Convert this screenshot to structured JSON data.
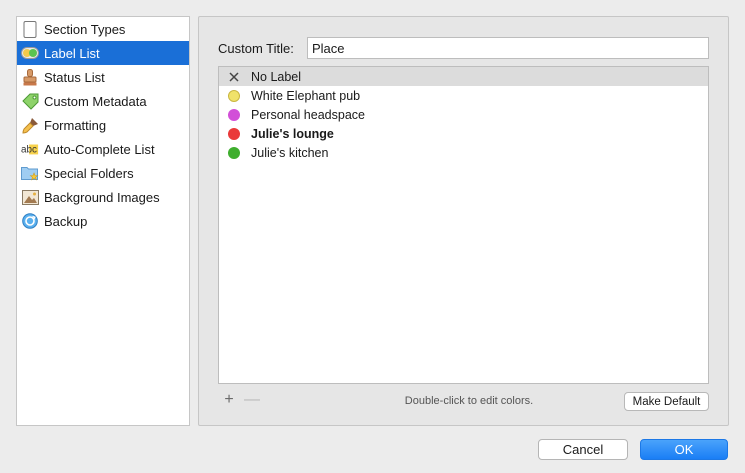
{
  "sidebar": {
    "items": [
      {
        "label": "Section Types",
        "icon": "document-icon"
      },
      {
        "label": "Label List",
        "icon": "label-toggle-icon",
        "selected": true
      },
      {
        "label": "Status List",
        "icon": "stamp-icon"
      },
      {
        "label": "Custom Metadata",
        "icon": "tag-icon"
      },
      {
        "label": "Formatting",
        "icon": "brush-icon"
      },
      {
        "label": "Auto-Complete List",
        "icon": "abc-icon"
      },
      {
        "label": "Special Folders",
        "icon": "folder-star-icon"
      },
      {
        "label": "Background Images",
        "icon": "picture-icon"
      },
      {
        "label": "Backup",
        "icon": "backup-icon"
      }
    ]
  },
  "form": {
    "custom_title_label": "Custom Title:",
    "custom_title_value": "Place"
  },
  "labels": [
    {
      "name": "No Label",
      "marker": "x",
      "color": null,
      "bold": false
    },
    {
      "name": "White Elephant pub",
      "marker": "dot",
      "color": "#f0e26a",
      "bold": false
    },
    {
      "name": "Personal headspace",
      "marker": "dot",
      "color": "#d24fd8",
      "bold": false
    },
    {
      "name": "Julie's lounge",
      "marker": "dot",
      "color": "#ea3a3a",
      "bold": true
    },
    {
      "name": "Julie's kitchen",
      "marker": "dot",
      "color": "#3fae2e",
      "bold": false
    }
  ],
  "list_footer": {
    "add_symbol": "+",
    "remove_symbol": "—",
    "hint": "Double-click to edit colors.",
    "make_default_label": "Make Default"
  },
  "dialog": {
    "cancel_label": "Cancel",
    "ok_label": "OK"
  },
  "colors": {
    "selection": "#1a6fd7",
    "ok_button": "#1a7ef5"
  }
}
